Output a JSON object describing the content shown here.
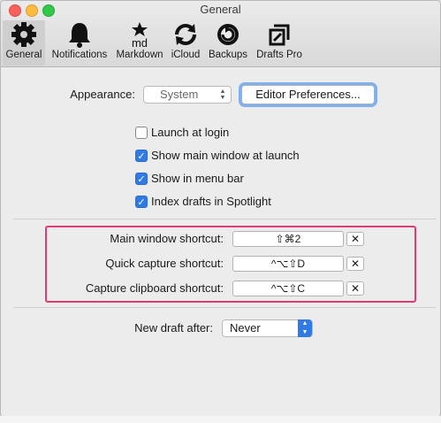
{
  "window": {
    "title": "General"
  },
  "toolbar": {
    "tabs": [
      {
        "label": "General",
        "icon": "gear-icon",
        "selected": true
      },
      {
        "label": "Notifications",
        "icon": "bell-icon",
        "selected": false
      },
      {
        "label": "Markdown",
        "icon": "markdown-icon",
        "selected": false
      },
      {
        "label": "iCloud",
        "icon": "sync-icon",
        "selected": false
      },
      {
        "label": "Backups",
        "icon": "backup-icon",
        "selected": false
      },
      {
        "label": "Drafts Pro",
        "icon": "drafts-pro-icon",
        "selected": false
      }
    ]
  },
  "appearance": {
    "label": "Appearance:",
    "value": "System",
    "editor_button": "Editor Preferences..."
  },
  "options": [
    {
      "label": "Launch at login",
      "checked": false
    },
    {
      "label": "Show main window at launch",
      "checked": true
    },
    {
      "label": "Show in menu bar",
      "checked": true
    },
    {
      "label": "Index drafts in Spotlight",
      "checked": true
    }
  ],
  "shortcuts": [
    {
      "label": "Main window shortcut:",
      "keys": "⇧⌘2"
    },
    {
      "label": "Quick capture shortcut:",
      "keys": "^⌥⇧D"
    },
    {
      "label": "Capture clipboard shortcut:",
      "keys": "^⌥⇧C"
    }
  ],
  "new_draft": {
    "label": "New draft after:",
    "value": "Never"
  },
  "colors": {
    "accent": "#2f7ae5",
    "highlight": "#e43a6d"
  }
}
